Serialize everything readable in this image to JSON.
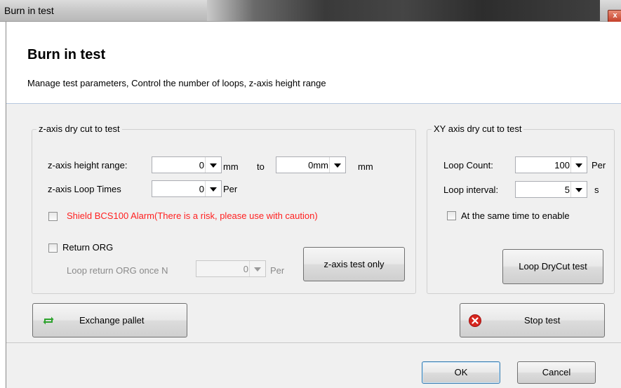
{
  "window": {
    "title": "Burn in test",
    "close_glyph": "x"
  },
  "header": {
    "title": "Burn in test",
    "description": "Manage test parameters, Control the number of loops, z-axis height range"
  },
  "z_group": {
    "label": "z-axis dry cut to test",
    "height_range_label": "z-axis height range:",
    "height_from": "0",
    "unit_mm": "mm",
    "to_label": "to",
    "height_to": "0mm",
    "unit_mm2": "mm",
    "loop_times_label": "z-axis Loop Times",
    "loop_times": "0",
    "unit_per": "Per",
    "shield_label": "Shield BCS100 Alarm(There is a risk, please use with caution)",
    "shield_color": "#ff2020",
    "return_org_label": "Return ORG",
    "loop_return_label": "Loop return ORG once N",
    "loop_return_value": "0",
    "loop_return_unit": "Per",
    "z_test_button": "z-axis test only"
  },
  "xy_group": {
    "label": "XY axis dry cut to test",
    "loop_count_label": "Loop Count:",
    "loop_count": "100",
    "loop_count_unit": "Per",
    "loop_interval_label": "Loop interval:",
    "loop_interval": "5",
    "loop_interval_unit": "s",
    "same_time_label": "At the same time to enable",
    "loop_drycut_button": "Loop DryCut test"
  },
  "actions": {
    "exchange_pallet": "Exchange pallet",
    "exchange_icon": "refresh-icon",
    "stop_test": "Stop test",
    "stop_icon": "error-icon",
    "ok": "OK",
    "cancel": "Cancel"
  }
}
